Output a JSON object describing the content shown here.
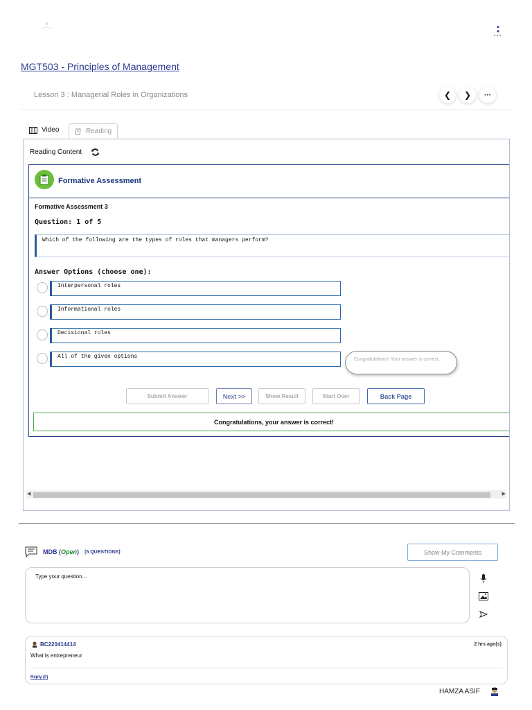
{
  "header": {
    "course_title": "MGT503 - Principles of Management",
    "lesson_title": "Lesson 3 : Managerial Roles in Organizations",
    "nav_prev_icon": "chevron-left-icon",
    "nav_next_icon": "chevron-right-icon",
    "nav_more_label": "···"
  },
  "tabs": {
    "video_label": "Video",
    "reading_label": "Reading"
  },
  "reading": {
    "content_label": "Reading Content",
    "assessment_title": "Formative Assessment",
    "assessment_subtitle": "Formative Assessment 3",
    "question_number": "Question: 1 of 5",
    "question_text": "Which of the following are the types of roles that managers perform?",
    "answer_label": "Answer Options (choose one):",
    "options": [
      "Interpersonal roles",
      "Informational roles",
      "Decisional roles",
      "All of the given options"
    ],
    "tooltip": "Congratulations! Your answer is correct.",
    "buttons": {
      "submit": "Submit Answer",
      "next": "Next >>",
      "show_result": "Show Result",
      "start_over": "Start Over",
      "back_page": "Back Page"
    },
    "result_message": "Congratulations, your answer is correct!"
  },
  "mdb": {
    "label": "MDB",
    "status": "Open",
    "count": "(5 QUESTIONS)",
    "show_comments": "Show My Comments",
    "input_placeholder": "Type your question...",
    "posts": [
      {
        "user": "BC220414414",
        "time": "2 hrs ago(s)",
        "text": "What is entrepreneur",
        "reply": "Reply (0)"
      }
    ]
  },
  "footer": {
    "user_name": "HAMZA ASIF"
  },
  "colors": {
    "accent": "#2b3a8f",
    "success": "#4aa84a",
    "assessment_icon": "#6cbf3a"
  }
}
